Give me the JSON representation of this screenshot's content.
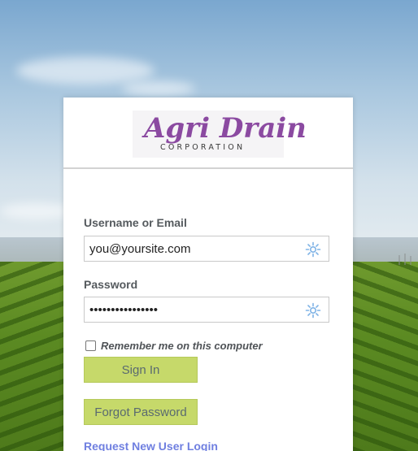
{
  "logo": {
    "main": "Agri Drain",
    "sub": "CORPORATION"
  },
  "form": {
    "username_label": "Username or Email",
    "username_value": "you@yoursite.com",
    "password_label": "Password",
    "password_value": "••••••••••••••••",
    "remember_label": "Remember me on this computer",
    "remember_checked": false
  },
  "buttons": {
    "sign_in": "Sign In",
    "forgot_password": "Forgot Password"
  },
  "links": {
    "request_login": "Request New User Login"
  },
  "icons": {
    "field_icon": "credential-manager-icon"
  },
  "colors": {
    "button_bg": "#c6d96a",
    "logo_purple": "#8b4aa1",
    "link_blue": "#6f7fe0"
  }
}
